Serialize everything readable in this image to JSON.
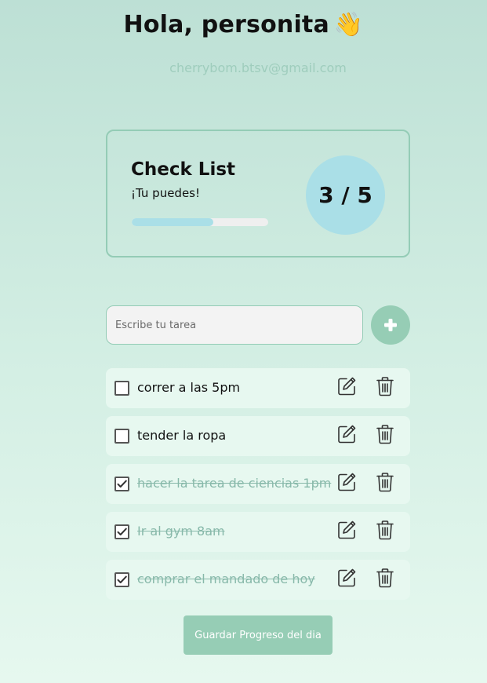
{
  "header": {
    "greeting": "Hola, personita",
    "wave_emoji": "👋",
    "email": "cherrybom.btsv@gmail.com"
  },
  "checklist_card": {
    "title": "Check List",
    "subtitle": "¡Tu puedes!",
    "completed": 3,
    "total": 5,
    "counter_text": "3 / 5",
    "progress_fraction": 0.6
  },
  "new_task": {
    "placeholder": "Escribe tu tarea",
    "value": "",
    "add_icon": "plus-icon"
  },
  "tasks": [
    {
      "text": "correr a las 5pm",
      "done": false
    },
    {
      "text": "tender la ropa",
      "done": false
    },
    {
      "text": "hacer la tarea de ciencias 1pm",
      "done": true
    },
    {
      "text": "Ir al gym 8am",
      "done": true
    },
    {
      "text": "comprar el mandado de hoy",
      "done": true
    }
  ],
  "task_icons": {
    "edit": "edit-icon",
    "delete": "trash-icon"
  },
  "save_button": {
    "label": "Guardar Progreso del dia"
  },
  "colors": {
    "accent": "#96cdb5",
    "counter_bg": "#aadfe7",
    "done_text": "#88b9aa",
    "task_bg": "#e7f8f0"
  }
}
